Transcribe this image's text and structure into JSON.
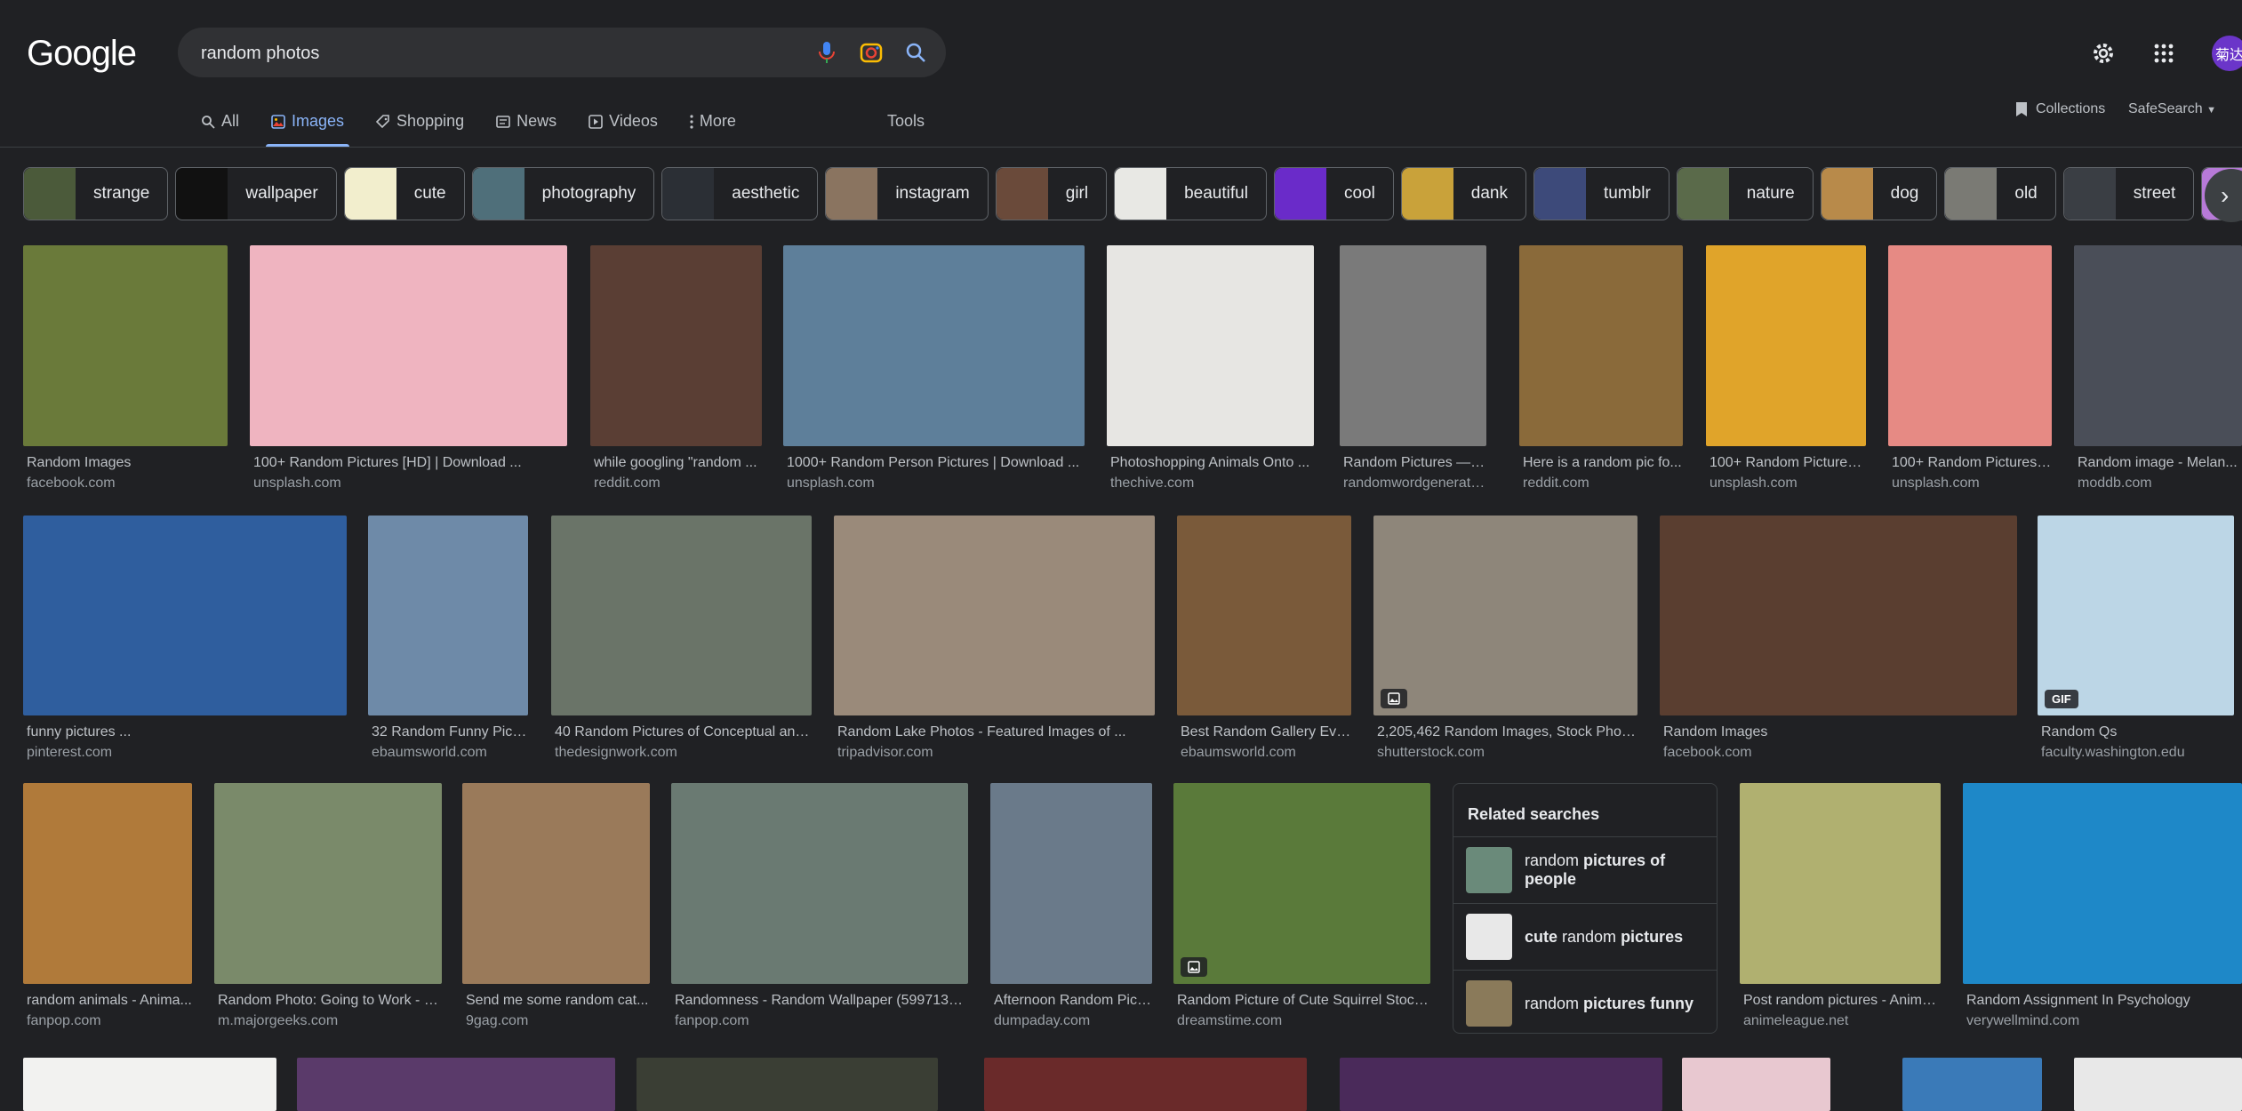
{
  "logo": "Google",
  "search": {
    "value": "random photos"
  },
  "header": {
    "avatar": "菊达"
  },
  "tabs": [
    {
      "label": "All",
      "icon": "search-icon"
    },
    {
      "label": "Images",
      "icon": "image-icon",
      "active": true
    },
    {
      "label": "Shopping",
      "icon": "tag-icon"
    },
    {
      "label": "News",
      "icon": "news-icon"
    },
    {
      "label": "Videos",
      "icon": "play-icon"
    },
    {
      "label": "More",
      "icon": "more-vert-icon"
    }
  ],
  "tools_label": "Tools",
  "collections_label": "Collections",
  "safesearch_label": "SafeSearch",
  "chips": [
    {
      "label": "strange",
      "color": "#4b5a3a"
    },
    {
      "label": "wallpaper",
      "color": "#111111"
    },
    {
      "label": "cute",
      "color": "#f2eecd"
    },
    {
      "label": "photography",
      "color": "#4f6f7a"
    },
    {
      "label": "aesthetic",
      "color": "#2b2f35"
    },
    {
      "label": "instagram",
      "color": "#8a7460"
    },
    {
      "label": "girl",
      "color": "#6a4a3a"
    },
    {
      "label": "beautiful",
      "color": "#e8e8e4"
    },
    {
      "label": "cool",
      "color": "#6a2bc9"
    },
    {
      "label": "dank",
      "color": "#c9a23a"
    },
    {
      "label": "tumblr",
      "color": "#3d4a7a"
    },
    {
      "label": "nature",
      "color": "#5a6a4a"
    },
    {
      "label": "dog",
      "color": "#b88a4a"
    },
    {
      "label": "old",
      "color": "#7a7a74"
    },
    {
      "label": "street",
      "color": "#3a3e44"
    },
    {
      "label": "",
      "color": "#b77ad8"
    }
  ],
  "images": [
    {
      "title": "Random Images",
      "site": "facebook.com",
      "color": "#6a7a3a",
      "badge": ""
    },
    {
      "title": "100+ Random Pictures [HD] | Download ...",
      "site": "unsplash.com",
      "color": "#efb4c0",
      "badge": ""
    },
    {
      "title": "while googling \"random ...",
      "site": "reddit.com",
      "color": "#5a3e34",
      "badge": ""
    },
    {
      "title": "1000+ Random Person Pictures | Download ...",
      "site": "unsplash.com",
      "color": "#5e7f9a",
      "badge": ""
    },
    {
      "title": "Photoshopping Animals Onto ...",
      "site": "thechive.com",
      "color": "#e7e6e3",
      "badge": ""
    },
    {
      "title": "Random Pictures — 10...",
      "site": "randomwordgenerator....",
      "color": "#7a7a7a",
      "badge": ""
    },
    {
      "title": "Here is a random pic fo...",
      "site": "reddit.com",
      "color": "#8a6a3a",
      "badge": ""
    },
    {
      "title": "100+ Random Pictures ...",
      "site": "unsplash.com",
      "color": "#e0a42a",
      "badge": ""
    },
    {
      "title": "100+ Random Pictures ...",
      "site": "unsplash.com",
      "color": "#e68a84",
      "badge": ""
    },
    {
      "title": "Random image - Melan...",
      "site": "moddb.com",
      "color": "#4a4e58",
      "badge": ""
    },
    {
      "title": "funny pictures ...",
      "site": "pinterest.com",
      "color": "#2f5e9e",
      "badge": ""
    },
    {
      "title": "32 Random Funny Pics...",
      "site": "ebaumsworld.com",
      "color": "#6e8aa8",
      "badge": ""
    },
    {
      "title": "40 Random Pictures of Conceptual and...",
      "site": "thedesignwork.com",
      "color": "#6a7468",
      "badge": ""
    },
    {
      "title": "Random Lake Photos - Featured Images of ...",
      "site": "tripadvisor.com",
      "color": "#9a8a7a",
      "badge": ""
    },
    {
      "title": "Best Random Gallery Ever...",
      "site": "ebaumsworld.com",
      "color": "#7a5a3a",
      "badge": ""
    },
    {
      "title": "2,205,462 Random Images, Stock Photo...",
      "site": "shutterstock.com",
      "color": "#8e867a",
      "badge": "image"
    },
    {
      "title": "Random Images",
      "site": "facebook.com",
      "color": "#5a3e30",
      "badge": ""
    },
    {
      "title": "Random Qs",
      "site": "faculty.washington.edu",
      "color": "#bcd6e6",
      "badge": "GIF"
    },
    {
      "title": "random animals - Anima...",
      "site": "fanpop.com",
      "color": "#b07a3a",
      "badge": ""
    },
    {
      "title": "Random Photo: Going to Work - M...",
      "site": "m.majorgeeks.com",
      "color": "#7a8a6a",
      "badge": ""
    },
    {
      "title": "Send me some random cat...",
      "site": "9gag.com",
      "color": "#9a7a5a",
      "badge": ""
    },
    {
      "title": "Randomness - Random Wallpaper (5997130 ...",
      "site": "fanpop.com",
      "color": "#6a7a72",
      "badge": ""
    },
    {
      "title": "Afternoon Random Pict...",
      "site": "dumpaday.com",
      "color": "#6a7a8a",
      "badge": ""
    },
    {
      "title": "Random Picture of Cute Squirrel Stock ...",
      "site": "dreamstime.com",
      "color": "#5a7a3a",
      "badge": "image"
    },
    {
      "title": "Post random pictures - Anime...",
      "site": "animeleague.net",
      "color": "#b0b070",
      "badge": ""
    },
    {
      "title": "Random Assignment In Psychology",
      "site": "verywellmind.com",
      "color": "#1e88c8",
      "badge": ""
    },
    {
      "title": "",
      "site": "",
      "color": "#f2f2f0",
      "badge": ""
    },
    {
      "title": "",
      "site": "",
      "color": "#5a3a6a",
      "badge": ""
    },
    {
      "title": "",
      "site": "",
      "color": "#3a3e34",
      "badge": ""
    },
    {
      "title": "",
      "site": "",
      "color": "#6a2a2a",
      "badge": ""
    },
    {
      "title": "",
      "site": "",
      "color": "#4a2a5a",
      "badge": ""
    },
    {
      "title": "",
      "site": "",
      "color": "#e8c8d0",
      "badge": ""
    },
    {
      "title": "",
      "site": "",
      "color": "#3a7ab8",
      "badge": ""
    },
    {
      "title": "",
      "site": "",
      "color": "#e8e8e8",
      "badge": ""
    }
  ],
  "related": {
    "heading": "Related searches",
    "items": [
      {
        "before": "random ",
        "bold": "pictures of people",
        "after": "",
        "color": "#6a8a7a"
      },
      {
        "before": "",
        "bold": "cute",
        "after": " random ",
        "bold2": "pictures",
        "color": "#e8e8e8"
      },
      {
        "before": "random ",
        "bold": "pictures funny",
        "after": "",
        "color": "#8a7a5a"
      }
    ]
  }
}
